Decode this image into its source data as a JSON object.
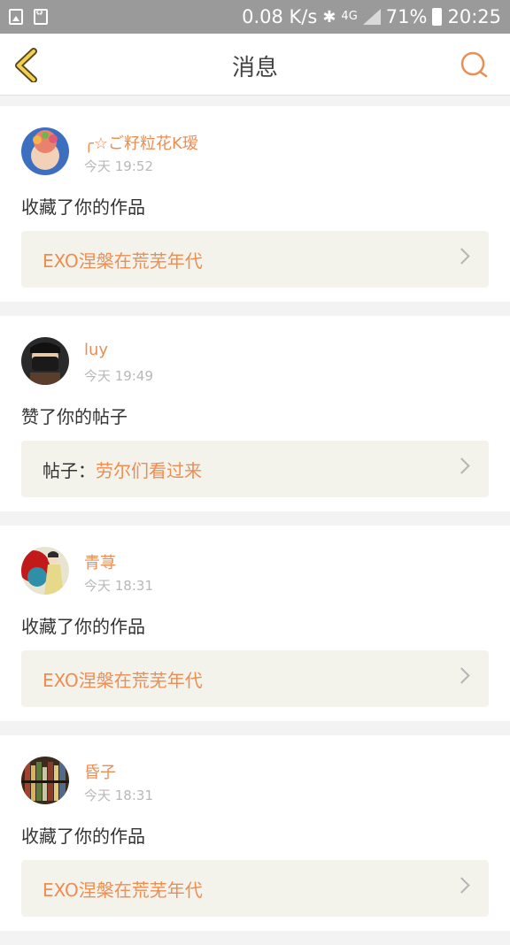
{
  "status_bar": {
    "speed": "0.08 K/s",
    "bluetooth_icon": "bluetooth-icon",
    "network_type": "4G",
    "battery_percent": "71%",
    "time": "20:25"
  },
  "header": {
    "title": "消息",
    "back_icon": "chevron-left-icon",
    "search_icon": "search-icon",
    "accent_color": "#ec8d52"
  },
  "messages": [
    {
      "username": "╭☆ご籽粒花K瑷",
      "time": "今天 19:52",
      "action": "收藏了你的作品",
      "target_prefix": "",
      "target_title": "EXO涅槃在荒芜年代"
    },
    {
      "username": "luy",
      "time": "今天 19:49",
      "action": "赞了你的帖子",
      "target_prefix": "帖子：",
      "target_title": "劳尔们看过来"
    },
    {
      "username": "青荨",
      "time": "今天 18:31",
      "action": "收藏了你的作品",
      "target_prefix": "",
      "target_title": "EXO涅槃在荒芜年代"
    },
    {
      "username": "昏子",
      "time": "今天 18:31",
      "action": "收藏了你的作品",
      "target_prefix": "",
      "target_title": "EXO涅槃在荒芜年代"
    }
  ]
}
